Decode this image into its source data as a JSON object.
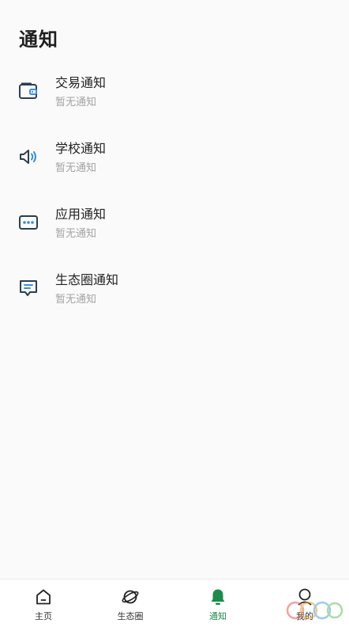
{
  "header": {
    "title": "通知"
  },
  "notifications": [
    {
      "icon": "wallet-icon",
      "title": "交易通知",
      "subtitle": "暂无通知"
    },
    {
      "icon": "speaker-icon",
      "title": "学校通知",
      "subtitle": "暂无通知"
    },
    {
      "icon": "app-dots-icon",
      "title": "应用通知",
      "subtitle": "暂无通知"
    },
    {
      "icon": "message-icon",
      "title": "生态圈通知",
      "subtitle": "暂无通知"
    }
  ],
  "tabbar": {
    "tabs": [
      {
        "icon": "home-icon",
        "label": "主页",
        "active": false
      },
      {
        "icon": "planet-icon",
        "label": "生态圈",
        "active": false
      },
      {
        "icon": "bell-icon",
        "label": "通知",
        "active": true
      },
      {
        "icon": "user-icon",
        "label": "我的",
        "active": false
      }
    ]
  },
  "colors": {
    "accent": "#1e8a4c",
    "icon_primary": "#2c3e50",
    "icon_secondary": "#3a8fd8"
  }
}
